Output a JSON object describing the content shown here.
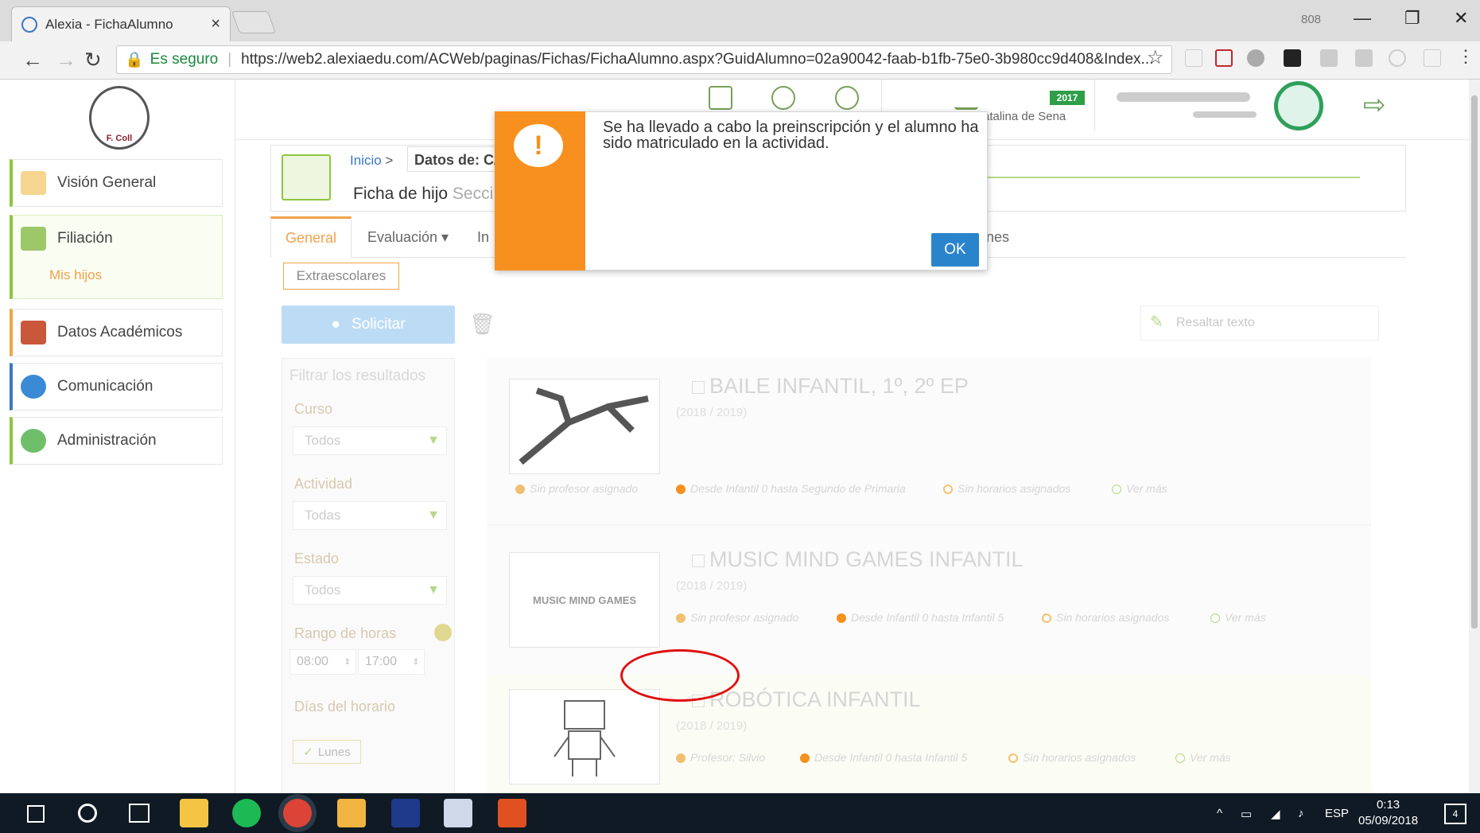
{
  "browser": {
    "tab_title": "Alexia - FichaAlumno",
    "tab_close": "×",
    "window_minimize": "—",
    "window_restore": "❐",
    "window_close": "✕",
    "window_user": "808",
    "secure_label": "Es seguro",
    "url": "https://web2.alexiaedu.com/ACWeb/paginas/Fichas/FichaAlumno.aspx?GuidAlumno=02a90042-faab-b1fb-75e0-3b980cc9d408&Index..."
  },
  "sidebar": {
    "logo_text": "F. Coll",
    "items": [
      {
        "label": "Visión General",
        "icon": "home-icon"
      },
      {
        "label": "Filiación",
        "icon": "id-card-icon"
      },
      {
        "label": "Datos Académicos",
        "icon": "graduation-cap-icon"
      },
      {
        "label": "Comunicación",
        "icon": "chat-icon"
      },
      {
        "label": "Administración",
        "icon": "gears-icon"
      }
    ],
    "sub_item": "Mis hijos"
  },
  "topbar": {
    "year_badge": "2017",
    "center_name": "atalina de Sena"
  },
  "breadcrumb": {
    "home": "Inicio",
    "separator": ">",
    "current": "Datos de: C/",
    "page_title": "Ficha de hijo",
    "page_subtitle": "Secci"
  },
  "tabs": [
    "General",
    "Evaluación ▾",
    "In",
    "nes"
  ],
  "subtab": "Extraescolares",
  "toolbar": {
    "request_label": "Solicitar",
    "highlight_placeholder": "Resaltar texto"
  },
  "filters": {
    "search_placeholder": "Filtrar los resultados",
    "course_label": "Curso",
    "course_value": "Todos",
    "activity_label": "Actividad",
    "activity_value": "Todas",
    "state_label": "Estado",
    "state_value": "Todos",
    "hours_label": "Rango de horas",
    "hour_from": "08:00",
    "hour_to": "17:00",
    "days_label": "Días del horario",
    "day_monday": "Lunes"
  },
  "activities": [
    {
      "title": "BAILE INFANTIL, 1º, 2º EP",
      "year": "(2018 / 2019)",
      "teacher": "Sin profesor asignado",
      "range": "Desde Infantil 0 hasta Segundo de Primaria",
      "schedule": "Sin horarios asignados",
      "more": "Ver más",
      "thumb": ""
    },
    {
      "title": "MUSIC MIND GAMES INFANTIL",
      "year": "(2018 / 2019)",
      "teacher": "Sin profesor asignado",
      "range": "Desde Infantil 0 hasta Infantil 5",
      "schedule": "Sin horarios asignados",
      "more": "Ver más",
      "thumb": "MUSIC MIND GAMES"
    },
    {
      "title": "ROBÓTICA INFANTIL",
      "year": "(2018 / 2019)",
      "teacher": "Profesor: Silvio",
      "range": "Desde Infantil 0 hasta Infantil 5",
      "schedule": "Sin horarios asignados",
      "more": "Ver más",
      "thumb": ""
    }
  ],
  "modal": {
    "message": "Se ha llevado a cabo la preinscripción y el alumno ha sido matriculado en la actividad.",
    "ok_label": "OK"
  },
  "taskbar": {
    "language": "ESP",
    "time": "0:13",
    "date": "05/09/2018",
    "notifications": "4"
  },
  "colors": {
    "accent_orange": "#f7901e",
    "accent_green": "#8dc63f",
    "ok_blue": "#2a84cc",
    "annotation_red": "#e01010"
  }
}
